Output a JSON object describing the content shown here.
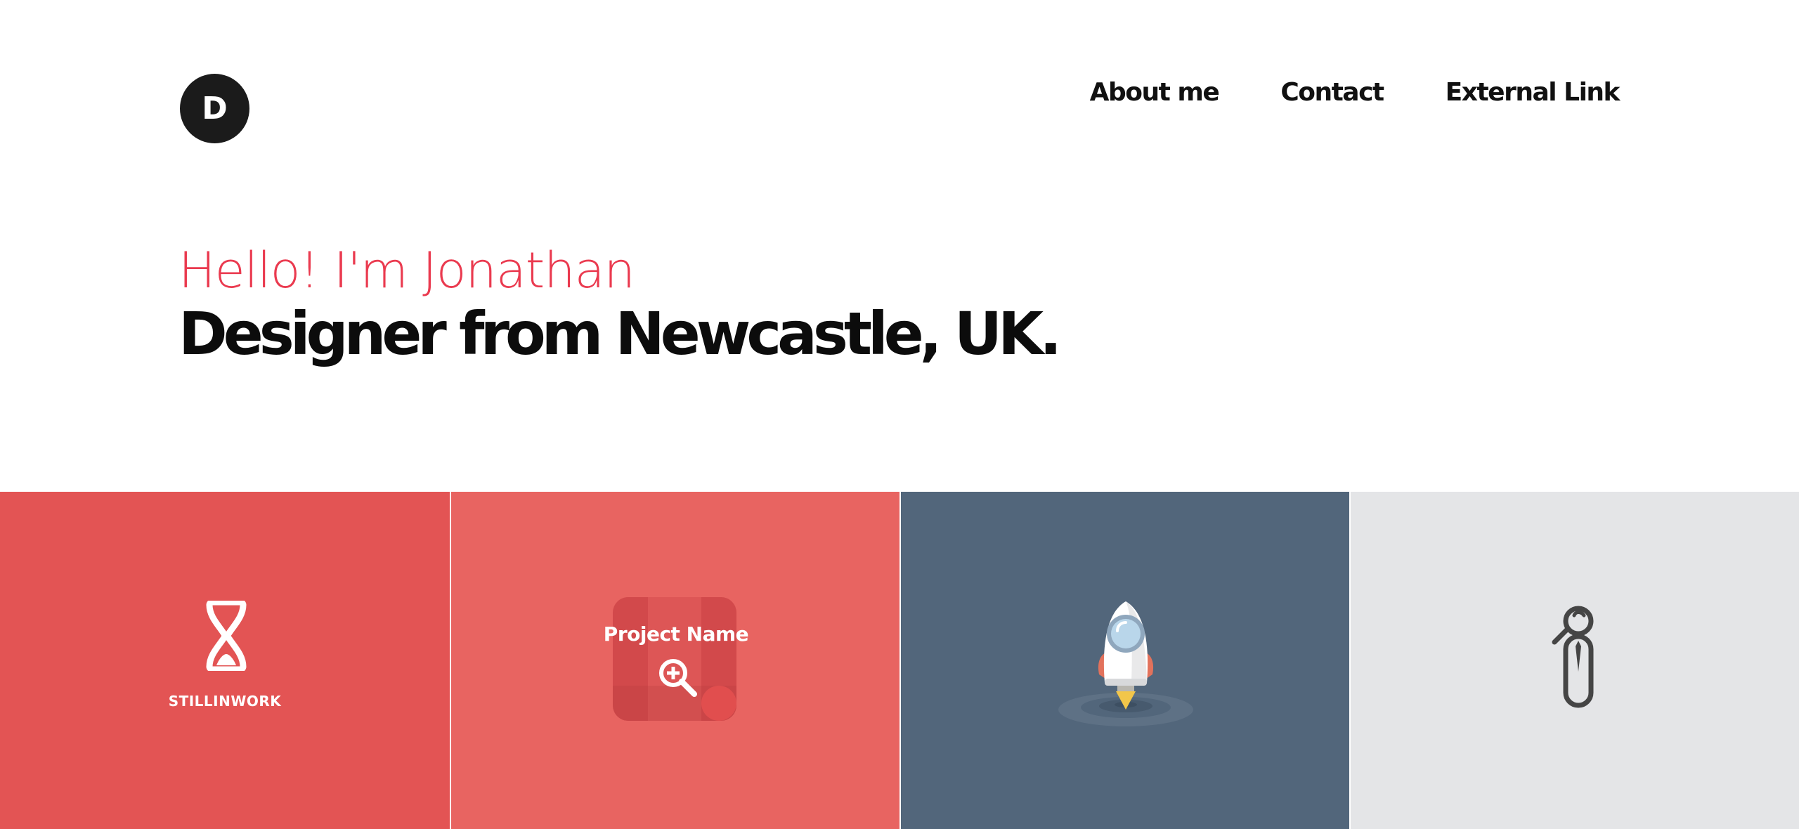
{
  "header": {
    "logo_letter": "D",
    "nav": [
      {
        "label": "About me"
      },
      {
        "label": "Contact"
      },
      {
        "label": "External Link"
      }
    ]
  },
  "hero": {
    "greeting": "Hello! I'm Jonathan",
    "title": "Designer from Newcastle, UK."
  },
  "tiles": [
    {
      "caption": "STILLINWORK",
      "color": "#e35454",
      "icon": "hourglass-icon"
    },
    {
      "hover_title": "Project Name",
      "color": "#e86461",
      "icon": "zoom-in-icon"
    },
    {
      "color": "#52667b",
      "icon": "rocket-icon"
    },
    {
      "color": "#e4e5e7",
      "icon": "paperclip-person-icon"
    }
  ],
  "colors": {
    "accent": "#ea3a4f",
    "text": "#0c0c0c"
  }
}
